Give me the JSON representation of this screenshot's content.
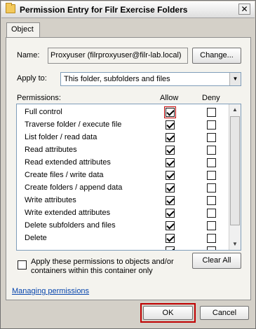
{
  "window": {
    "title": "Permission Entry for Filr Exercise Folders",
    "close_glyph": "✕"
  },
  "tabs": [
    {
      "label": "Object",
      "active": true
    }
  ],
  "name_field": {
    "label": "Name:",
    "value": "Proxyuser (filrproxyuser@filr-lab.local)",
    "change_button": "Change..."
  },
  "apply_to": {
    "label": "Apply to:",
    "selected": "This folder, subfolders and files"
  },
  "permissions": {
    "header": "Permissions:",
    "allow_header": "Allow",
    "deny_header": "Deny",
    "rows": [
      {
        "label": "Full control",
        "allow": true,
        "deny": false
      },
      {
        "label": "Traverse folder / execute file",
        "allow": true,
        "deny": false
      },
      {
        "label": "List folder / read data",
        "allow": true,
        "deny": false
      },
      {
        "label": "Read attributes",
        "allow": true,
        "deny": false
      },
      {
        "label": "Read extended attributes",
        "allow": true,
        "deny": false
      },
      {
        "label": "Create files / write data",
        "allow": true,
        "deny": false
      },
      {
        "label": "Create folders / append data",
        "allow": true,
        "deny": false
      },
      {
        "label": "Write attributes",
        "allow": true,
        "deny": false
      },
      {
        "label": "Write extended attributes",
        "allow": true,
        "deny": false
      },
      {
        "label": "Delete subfolders and files",
        "allow": true,
        "deny": false
      },
      {
        "label": "Delete",
        "allow": true,
        "deny": false
      },
      {
        "label": "",
        "allow": true,
        "deny": false
      }
    ]
  },
  "apply_container": {
    "label": "Apply these permissions to objects and/or containers within this container only",
    "checked": false,
    "clear_all_button": "Clear All"
  },
  "link": {
    "label": "Managing permissions"
  },
  "footer": {
    "ok": "OK",
    "cancel": "Cancel"
  },
  "colors": {
    "highlight": "#c00000",
    "dialog_bg": "#d4d0c8",
    "link": "#0645ad"
  }
}
